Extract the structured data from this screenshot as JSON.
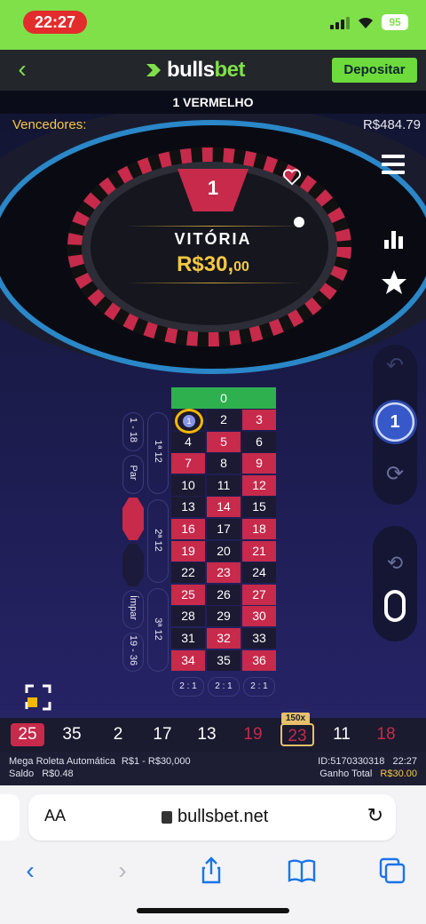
{
  "status": {
    "time": "22:27",
    "battery": "95"
  },
  "header": {
    "brand_prefix": "bulls",
    "brand_suffix": "bet",
    "deposit_label": "Depositar"
  },
  "result": {
    "text": "1 VERMELHO"
  },
  "game": {
    "winners_label": "Vencedores:",
    "winners_amount": "R$484.79",
    "winning_number": "1",
    "win_title": "VITÓRIA",
    "win_amount_main": "R$30,",
    "win_amount_cents": "00",
    "chip_value": "1",
    "zero": "0",
    "side_labels": {
      "low": "1 - 18",
      "even": "Par",
      "odd": "Ímpar",
      "high": "19 - 36",
      "dozen1": "1ª 12",
      "dozen2": "2ª 12",
      "dozen3": "3ª 12"
    },
    "column_bet": "2 : 1",
    "numbers": [
      {
        "n": "1",
        "c": "blue"
      },
      {
        "n": "2",
        "c": "black"
      },
      {
        "n": "3",
        "c": "red"
      },
      {
        "n": "4",
        "c": "black"
      },
      {
        "n": "5",
        "c": "red"
      },
      {
        "n": "6",
        "c": "black"
      },
      {
        "n": "7",
        "c": "red"
      },
      {
        "n": "8",
        "c": "black"
      },
      {
        "n": "9",
        "c": "red"
      },
      {
        "n": "10",
        "c": "black"
      },
      {
        "n": "11",
        "c": "black"
      },
      {
        "n": "12",
        "c": "red"
      },
      {
        "n": "13",
        "c": "black"
      },
      {
        "n": "14",
        "c": "red"
      },
      {
        "n": "15",
        "c": "black"
      },
      {
        "n": "16",
        "c": "red"
      },
      {
        "n": "17",
        "c": "black"
      },
      {
        "n": "18",
        "c": "red"
      },
      {
        "n": "19",
        "c": "red"
      },
      {
        "n": "20",
        "c": "black"
      },
      {
        "n": "21",
        "c": "red"
      },
      {
        "n": "22",
        "c": "black"
      },
      {
        "n": "23",
        "c": "red"
      },
      {
        "n": "24",
        "c": "black"
      },
      {
        "n": "25",
        "c": "red"
      },
      {
        "n": "26",
        "c": "black"
      },
      {
        "n": "27",
        "c": "red"
      },
      {
        "n": "28",
        "c": "black"
      },
      {
        "n": "29",
        "c": "black"
      },
      {
        "n": "30",
        "c": "red"
      },
      {
        "n": "31",
        "c": "black"
      },
      {
        "n": "32",
        "c": "red"
      },
      {
        "n": "33",
        "c": "black"
      },
      {
        "n": "34",
        "c": "red"
      },
      {
        "n": "35",
        "c": "black"
      },
      {
        "n": "36",
        "c": "red"
      }
    ]
  },
  "history": {
    "multiplier": "150x",
    "items": [
      {
        "n": "25",
        "c": "first"
      },
      {
        "n": "35",
        "c": "black"
      },
      {
        "n": "2",
        "c": "black"
      },
      {
        "n": "17",
        "c": "black"
      },
      {
        "n": "13",
        "c": "black"
      },
      {
        "n": "19",
        "c": "red"
      },
      {
        "n": "23",
        "c": "boosted"
      },
      {
        "n": "11",
        "c": "black"
      },
      {
        "n": "18",
        "c": "red"
      }
    ]
  },
  "info": {
    "game_name": "Mega Roleta Automática",
    "limits": "R$1 - R$30,000",
    "balance_label": "Saldo",
    "balance": "R$0.48",
    "round_id": "ID:5170330318",
    "round_time": "22:27",
    "total_win_label": "Ganho Total",
    "total_win": "R$30.00"
  },
  "browser": {
    "aa": "AA",
    "url": "bullsbet.net"
  },
  "colors": {
    "red": "#c72a4a",
    "black": "#1b1a32",
    "green": "#2fb04e",
    "brand": "#7fe04a",
    "gold": "#f5c842"
  }
}
